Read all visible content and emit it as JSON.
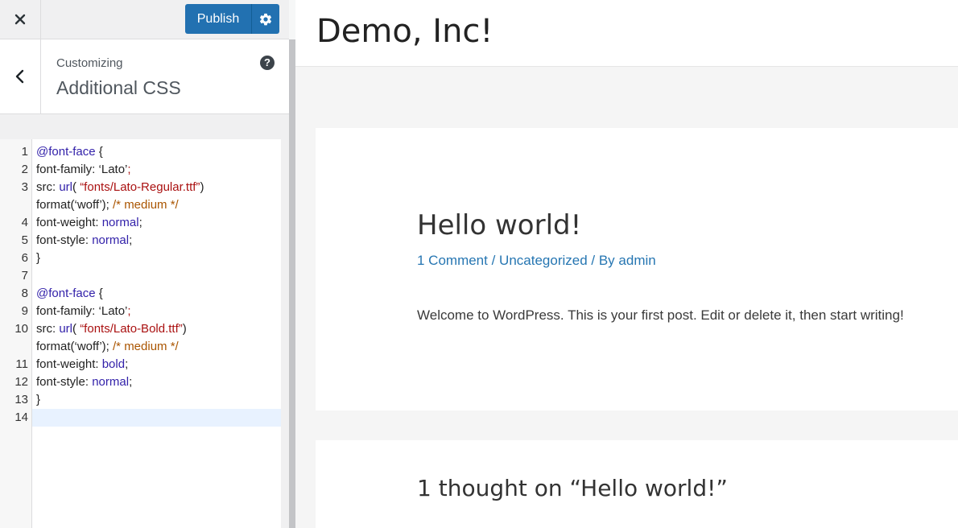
{
  "toolbar": {
    "publish_label": "Publish",
    "close_icon": "close-icon",
    "settings_icon": "gear-icon"
  },
  "section": {
    "breadcrumb": "Customizing",
    "title": "Additional CSS",
    "help_symbol": "?"
  },
  "editor": {
    "lines": [
      {
        "num": "1",
        "segments": [
          {
            "t": "@font-face",
            "c": "kw"
          },
          {
            "t": " {",
            "c": ""
          }
        ]
      },
      {
        "num": "2",
        "segments": [
          {
            "t": " font-family: ‘Lato’",
            "c": ""
          },
          {
            "t": ";",
            "c": "str"
          }
        ]
      },
      {
        "num": "3",
        "segments": [
          {
            "t": " src: ",
            "c": ""
          },
          {
            "t": "url",
            "c": "kw"
          },
          {
            "t": "( ",
            "c": ""
          },
          {
            "t": "“fonts/Lato-Regular.ttf”",
            "c": "str"
          },
          {
            "t": ")",
            "c": ""
          }
        ]
      },
      {
        "num": "",
        "segments": [
          {
            "t": "format(‘woff’); ",
            "c": ""
          },
          {
            "t": "/* medium */",
            "c": "cmt"
          }
        ]
      },
      {
        "num": "4",
        "segments": [
          {
            "t": " font-weight: ",
            "c": ""
          },
          {
            "t": "normal",
            "c": "kw"
          },
          {
            "t": ";",
            "c": ""
          }
        ]
      },
      {
        "num": "5",
        "segments": [
          {
            "t": " font-style: ",
            "c": ""
          },
          {
            "t": "normal",
            "c": "kw"
          },
          {
            "t": ";",
            "c": ""
          }
        ]
      },
      {
        "num": "6",
        "segments": [
          {
            "t": "}",
            "c": ""
          }
        ]
      },
      {
        "num": "7",
        "segments": []
      },
      {
        "num": "8",
        "segments": [
          {
            "t": "@font-face",
            "c": "kw"
          },
          {
            "t": " {",
            "c": ""
          }
        ]
      },
      {
        "num": "9",
        "segments": [
          {
            "t": " font-family: ‘Lato’",
            "c": ""
          },
          {
            "t": ";",
            "c": "str"
          }
        ]
      },
      {
        "num": "10",
        "segments": [
          {
            "t": " src: ",
            "c": ""
          },
          {
            "t": "url",
            "c": "kw"
          },
          {
            "t": "( ",
            "c": ""
          },
          {
            "t": "“fonts/Lato-Bold.ttf”",
            "c": "str"
          },
          {
            "t": ")",
            "c": ""
          }
        ]
      },
      {
        "num": "",
        "segments": [
          {
            "t": "format(‘woff’); ",
            "c": ""
          },
          {
            "t": "/* medium */",
            "c": "cmt"
          }
        ]
      },
      {
        "num": "11",
        "segments": [
          {
            "t": " font-weight: ",
            "c": ""
          },
          {
            "t": "bold",
            "c": "kw"
          },
          {
            "t": ";",
            "c": ""
          }
        ]
      },
      {
        "num": "12",
        "segments": [
          {
            "t": " font-style: ",
            "c": ""
          },
          {
            "t": "normal",
            "c": "kw"
          },
          {
            "t": ";",
            "c": ""
          }
        ]
      },
      {
        "num": "13",
        "segments": [
          {
            "t": "}",
            "c": ""
          }
        ]
      },
      {
        "num": "14",
        "segments": []
      }
    ]
  },
  "preview": {
    "site_title": "Demo, Inc!",
    "post": {
      "title": "Hello world!",
      "meta_comments": "1 Comment",
      "meta_sep1": " / ",
      "meta_category": "Uncategorized",
      "meta_sep2": " / By ",
      "meta_author": "admin",
      "excerpt": "Welcome to WordPress. This is your first post. Edit or delete it, then start writing!"
    },
    "comments_title": "1 thought on “Hello world!”"
  }
}
